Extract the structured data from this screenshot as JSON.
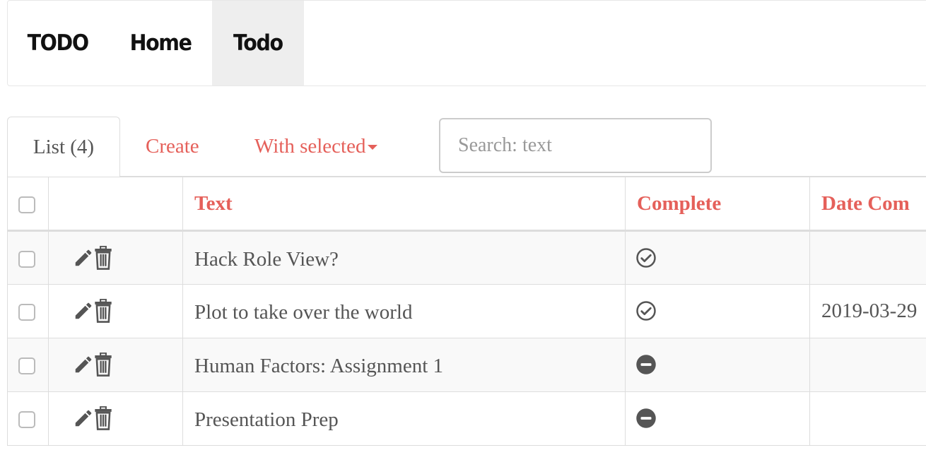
{
  "navbar": {
    "brand": "TODO",
    "links": [
      {
        "label": "Home",
        "active": false
      },
      {
        "label": "Todo",
        "active": true
      }
    ]
  },
  "tabs": {
    "list_label": "List (4)",
    "create_label": "Create",
    "with_selected_label": "With selected"
  },
  "search": {
    "placeholder": "Search: text",
    "value": ""
  },
  "table": {
    "columns": [
      "Text",
      "Complete",
      "Date Com"
    ],
    "rows": [
      {
        "text": "Hack Role View?",
        "complete": "check-circle-icon",
        "date": ""
      },
      {
        "text": "Plot to take over the world",
        "complete": "check-circle-icon",
        "date": "2019-03-29"
      },
      {
        "text": "Human Factors: Assignment 1",
        "complete": "minus-circle-icon",
        "date": ""
      },
      {
        "text": "Presentation Prep",
        "complete": "minus-circle-icon",
        "date": ""
      }
    ]
  },
  "colors": {
    "accent": "#e5605a",
    "text": "#555555",
    "nav_active_bg": "#eeeeee",
    "border": "#dddddd"
  }
}
